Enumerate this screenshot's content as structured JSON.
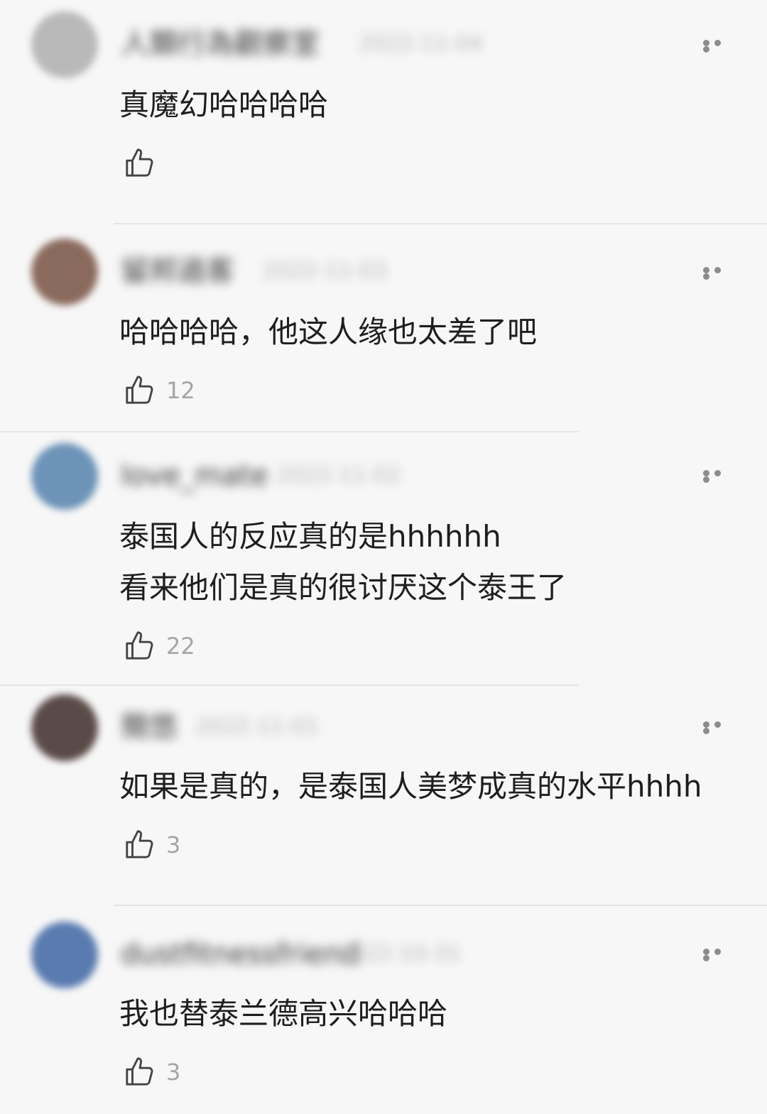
{
  "comments": [
    {
      "username": "人類行為觀察室",
      "timestamp": "2022-11-04",
      "lines": [
        "真魔幻哈哈哈哈"
      ],
      "likes": "",
      "avatar_color": "#b9b9b9"
    },
    {
      "username": "留邦過客",
      "timestamp": "2022-11-03",
      "lines": [
        "哈哈哈哈，他这人缘也太差了吧"
      ],
      "likes": "12",
      "avatar_color": "#8a6a5c"
    },
    {
      "username": "love_mate",
      "timestamp": "2022-11-02",
      "lines": [
        "泰国人的反应真的是hhhhhh",
        "看来他们是真的很讨厌这个泰王了"
      ],
      "likes": "22",
      "avatar_color": "#6d93b8"
    },
    {
      "username": "簡悠",
      "timestamp": "2022-11-01",
      "lines": [
        "如果是真的，是泰国人美梦成真的水平hhhh"
      ],
      "likes": "3",
      "avatar_color": "#5a4a48"
    },
    {
      "username": "dustfitnessfriend",
      "timestamp": "2022-10-31",
      "lines": [
        "我也替泰兰德高兴哈哈哈"
      ],
      "likes": "3",
      "avatar_color": "#5a7bb0"
    }
  ],
  "icons": {
    "like": "thumbs-up-icon",
    "more": "more-options-icon"
  },
  "colors": {
    "background": "#f7f7f7",
    "text": "#1e1e1e",
    "like_count": "#a5a5a5",
    "divider": "#e4e4e4"
  }
}
